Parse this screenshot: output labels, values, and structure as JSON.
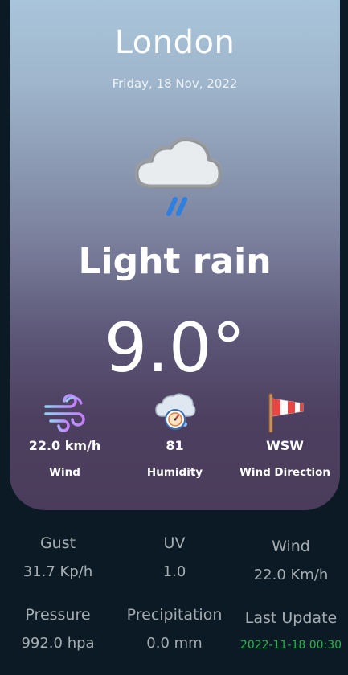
{
  "location": {
    "city": "London",
    "date": "Friday, 18 Nov, 2022"
  },
  "current": {
    "condition": "Light rain",
    "condition_icon": "cloud-rain-icon",
    "temperature": "9.0°"
  },
  "stats": [
    {
      "value": "22.0 km/h",
      "label": "Wind",
      "icon": "wind-icon"
    },
    {
      "value": "81",
      "label": "Humidity",
      "icon": "humidity-icon"
    },
    {
      "value": "WSW",
      "label": "Wind Direction",
      "icon": "windsock-icon"
    }
  ],
  "details": [
    {
      "label": "Gust",
      "value": "31.7 Kp/h"
    },
    {
      "label": "UV",
      "value": "1.0"
    },
    {
      "label": "Wind",
      "value": "22.0 Km/h"
    },
    {
      "label": "Pressure",
      "value": "992.0 hpa"
    },
    {
      "label": "Precipitation",
      "value": "0.0 mm"
    },
    {
      "label": "Last Update",
      "value": "2022-11-18 00:30"
    }
  ],
  "colors": {
    "background": "#0b1a24",
    "detail_text": "#a6adb2",
    "update_green": "#22b84a"
  }
}
